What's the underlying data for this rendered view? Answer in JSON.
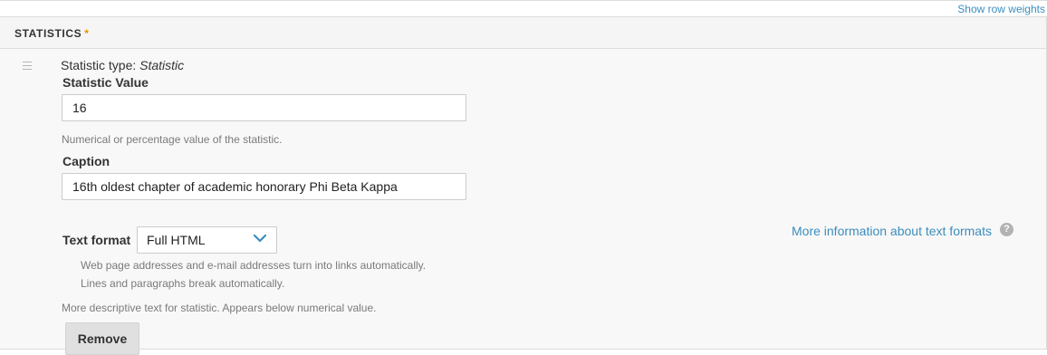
{
  "header": {
    "show_row_weights": "Show row weights"
  },
  "table": {
    "title": "STATISTICS",
    "required_marker": "*"
  },
  "row": {
    "type_prefix": "Statistic type: ",
    "type_name": "Statistic",
    "drag_icon": "drag-handle-icon"
  },
  "fields": {
    "value_label": "Statistic Value",
    "value": "16",
    "value_description": "Numerical or percentage value of the statistic.",
    "caption_label": "Caption",
    "caption": "16th oldest chapter of academic honorary Phi Beta Kappa",
    "format_label": "Text format",
    "format_selected": "Full HTML",
    "format_tip_1": "Web page addresses and e-mail addresses turn into links automatically.",
    "format_tip_2": "Lines and paragraphs break automatically.",
    "more_info": "More information about text formats",
    "help_symbol": "?",
    "caption_description": "More descriptive text for statistic. Appears below numerical value.",
    "remove_label": "Remove"
  },
  "colors": {
    "link": "#3b8dbd",
    "required": "#e29700",
    "row_bg": "#f8f8f8",
    "header_bg": "#f5f5f5"
  }
}
